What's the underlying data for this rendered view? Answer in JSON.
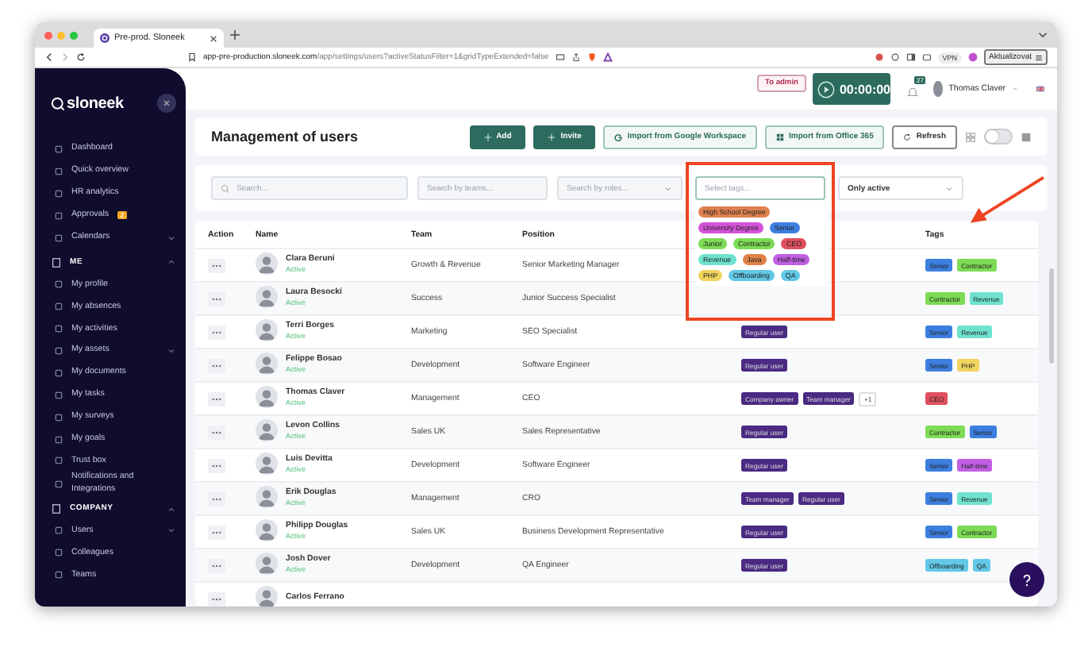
{
  "browser": {
    "tab_title": "Pre-prod. Sloneek",
    "url_domain": "app-pre-production.sloneek.com",
    "url_path": "/app/settings/users?activeStatusFilter=1&gridTypeExtended=false",
    "vpn": "VPN",
    "update_button": "Aktualizovat"
  },
  "header": {
    "admin_button": "To admin",
    "timer": "00:00:00",
    "notification_count": "27",
    "user_name": "Thomas Claver"
  },
  "sidebar": {
    "logo": "sloneek",
    "items": [
      {
        "label": "Dashboard",
        "kind": "item"
      },
      {
        "label": "Quick overview",
        "kind": "item"
      },
      {
        "label": "HR analytics",
        "kind": "item"
      },
      {
        "label": "Approvals",
        "kind": "item",
        "badge": "2"
      },
      {
        "label": "Calendars",
        "kind": "menu",
        "expanded": false
      },
      {
        "label": "ME",
        "kind": "section",
        "expanded": true
      },
      {
        "label": "My profile",
        "kind": "item"
      },
      {
        "label": "My absences",
        "kind": "item"
      },
      {
        "label": "My activities",
        "kind": "item"
      },
      {
        "label": "My assets",
        "kind": "menu",
        "expanded": false
      },
      {
        "label": "My documents",
        "kind": "item"
      },
      {
        "label": "My tasks",
        "kind": "item"
      },
      {
        "label": "My surveys",
        "kind": "item"
      },
      {
        "label": "My goals",
        "kind": "item"
      },
      {
        "label": "Trust box",
        "kind": "item"
      },
      {
        "label": "Notifications and Integrations",
        "kind": "item"
      },
      {
        "label": "COMPANY",
        "kind": "section",
        "expanded": true
      },
      {
        "label": "Users",
        "kind": "menu",
        "expanded": false
      },
      {
        "label": "Colleagues",
        "kind": "item"
      },
      {
        "label": "Teams",
        "kind": "item"
      }
    ]
  },
  "page": {
    "title": "Management of users",
    "buttons": [
      {
        "label": "Add",
        "kind": "primary"
      },
      {
        "label": "Invite",
        "kind": "primary"
      },
      {
        "label": "Import from Google Workspace",
        "kind": "google"
      },
      {
        "label": "Import from Office 365",
        "kind": "office"
      },
      {
        "label": "Refresh",
        "kind": "refresh"
      }
    ],
    "view_toggle": {
      "on": false
    }
  },
  "filters": {
    "search": {
      "placeholder": "Search..."
    },
    "teams": {
      "placeholder": "Search by teams..."
    },
    "roles": {
      "placeholder": "Search by roles..."
    },
    "tags": {
      "placeholder": "Select tags...",
      "expanded": true
    },
    "status": {
      "value": "Only active"
    }
  },
  "tag_dropdown": {
    "options": [
      {
        "label": "High School Degree",
        "color": "#e0804f"
      },
      {
        "label": "University Degree",
        "color": "#d452d8"
      },
      {
        "label": "Senior",
        "color": "#3d7fe0"
      },
      {
        "label": "Junior",
        "color": "#7ddb55"
      },
      {
        "label": "Contractor",
        "color": "#7ddb55"
      },
      {
        "label": "CEO",
        "color": "#e0505f"
      },
      {
        "label": "Revenue",
        "color": "#6fe2cf"
      },
      {
        "label": "Java",
        "color": "#e08245"
      },
      {
        "label": "Half-time",
        "color": "#c15fe3"
      },
      {
        "label": "PHP",
        "color": "#f1d45e"
      },
      {
        "label": "Offboarding",
        "color": "#62c8e6"
      },
      {
        "label": "QA",
        "color": "#62c8e6"
      }
    ]
  },
  "table": {
    "columns": [
      "Action",
      "Name",
      "Team",
      "Position",
      "Tags"
    ],
    "rows": [
      {
        "name": "Clara Beruni",
        "status": "Active",
        "team": "Growth & Revenue",
        "position": "Senior Marketing Manager",
        "roles": [],
        "tags": [
          {
            "label": "Senior",
            "color": "#3d7fe0"
          },
          {
            "label": "Contractor",
            "color": "#7ddb55"
          }
        ]
      },
      {
        "name": "Laura Besocki",
        "status": "Active",
        "team": "Success",
        "position": "Junior Success Specialist",
        "roles": [],
        "tags": [
          {
            "label": "Contractor",
            "color": "#7ddb55"
          },
          {
            "label": "Revenue",
            "color": "#6fe2cf"
          }
        ]
      },
      {
        "name": "Terri Borges",
        "status": "Active",
        "team": "Marketing",
        "position": "SEO Specialist",
        "roles": [
          "Regular user"
        ],
        "tags": [
          {
            "label": "Senior",
            "color": "#3d7fe0"
          },
          {
            "label": "Revenue",
            "color": "#6fe2cf"
          }
        ]
      },
      {
        "name": "Felippe Bosao",
        "status": "Active",
        "team": "Development",
        "position": "Software Engineer",
        "roles": [
          "Regular user"
        ],
        "tags": [
          {
            "label": "Senior",
            "color": "#3d7fe0"
          },
          {
            "label": "PHP",
            "color": "#f1d45e"
          }
        ]
      },
      {
        "name": "Thomas Claver",
        "status": "Active",
        "team": "Management",
        "position": "CEO",
        "roles": [
          "Company owner",
          "Team manager"
        ],
        "more_roles": "+1",
        "tags": [
          {
            "label": "CEO",
            "color": "#e0505f"
          }
        ]
      },
      {
        "name": "Levon Collins",
        "status": "Active",
        "team": "Sales UK",
        "position": "Sales Representative",
        "roles": [
          "Regular user"
        ],
        "tags": [
          {
            "label": "Contractor",
            "color": "#7ddb55"
          },
          {
            "label": "Senior",
            "color": "#3d7fe0"
          }
        ]
      },
      {
        "name": "Luis Devitta",
        "status": "Active",
        "team": "Development",
        "position": "Software Engineer",
        "roles": [
          "Regular user"
        ],
        "tags": [
          {
            "label": "Senior",
            "color": "#3d7fe0"
          },
          {
            "label": "Half-time",
            "color": "#c15fe3"
          }
        ]
      },
      {
        "name": "Erik Douglas",
        "status": "Active",
        "team": "Management",
        "position": "CRO",
        "roles": [
          "Team manager",
          "Regular user"
        ],
        "tags": [
          {
            "label": "Senior",
            "color": "#3d7fe0"
          },
          {
            "label": "Revenue",
            "color": "#6fe2cf"
          }
        ]
      },
      {
        "name": "Philipp Douglas",
        "status": "Active",
        "team": "Sales UK",
        "position": "Business Development Representative",
        "roles": [
          "Regular user"
        ],
        "tags": [
          {
            "label": "Senior",
            "color": "#3d7fe0"
          },
          {
            "label": "Contractor",
            "color": "#7ddb55"
          }
        ]
      },
      {
        "name": "Josh Dover",
        "status": "Active",
        "team": "Development",
        "position": "QA Engineer",
        "roles": [
          "Regular user"
        ],
        "tags": [
          {
            "label": "Offboarding",
            "color": "#62c8e6"
          },
          {
            "label": "QA",
            "color": "#62c8e6"
          }
        ]
      },
      {
        "name": "Carlos Ferrano",
        "roles": [],
        "tags": []
      }
    ]
  }
}
